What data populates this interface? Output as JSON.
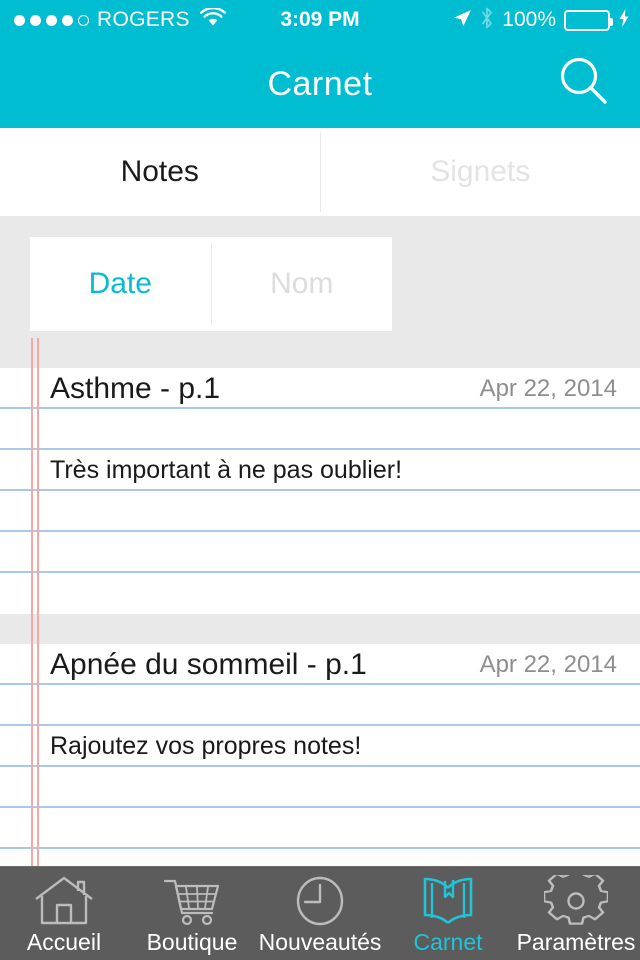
{
  "statusbar": {
    "carrier": "ROGERS",
    "signal_dots_filled": 4,
    "signal_dots_total": 5,
    "wifi_icon": "wifi-icon",
    "time": "3:09 PM",
    "location_icon": "location-arrow-icon",
    "bluetooth_icon": "bluetooth-icon",
    "battery_percent": "100%",
    "battery_icon": "battery-full-icon",
    "charging_icon": "lightning-bolt-icon",
    "battery_color": "#4cd964"
  },
  "navbar": {
    "title": "Carnet",
    "search_icon": "search-icon",
    "background_color": "#00bdd1"
  },
  "top_tabs": {
    "items": [
      {
        "label": "Notes",
        "active": true
      },
      {
        "label": "Signets",
        "active": false
      }
    ]
  },
  "sort_segment": {
    "items": [
      {
        "label": "Date",
        "active": true
      },
      {
        "label": "Nom",
        "active": false
      }
    ],
    "active_color": "#07bcd2"
  },
  "notes": [
    {
      "title": "Asthme - p.1",
      "date": "Apr 22, 2014",
      "text": "Très important à ne pas oublier!",
      "blank_lines_before_text": 1,
      "blank_lines_after_text": 3
    },
    {
      "title": "Apnée du sommeil - p.1",
      "date": "Apr 22, 2014",
      "text": "Rajoutez vos propres notes!",
      "blank_lines_before_text": 1,
      "blank_lines_after_text": 3
    }
  ],
  "paper": {
    "rule_color": "#a8c9ec",
    "margin_rule_color": "#f7a8a4",
    "separator_color": "#e9e9e9"
  },
  "tabbar": {
    "background_color": "#5c5c5c",
    "active_color": "#1fc4d8",
    "items": [
      {
        "label": "Accueil",
        "icon": "house-icon",
        "active": false
      },
      {
        "label": "Boutique",
        "icon": "shopping-cart-icon",
        "active": false
      },
      {
        "label": "Nouveautés",
        "icon": "clock-icon",
        "active": false
      },
      {
        "label": "Carnet",
        "icon": "open-book-icon",
        "active": true
      },
      {
        "label": "Paramètres",
        "icon": "gear-icon",
        "active": false
      }
    ]
  }
}
